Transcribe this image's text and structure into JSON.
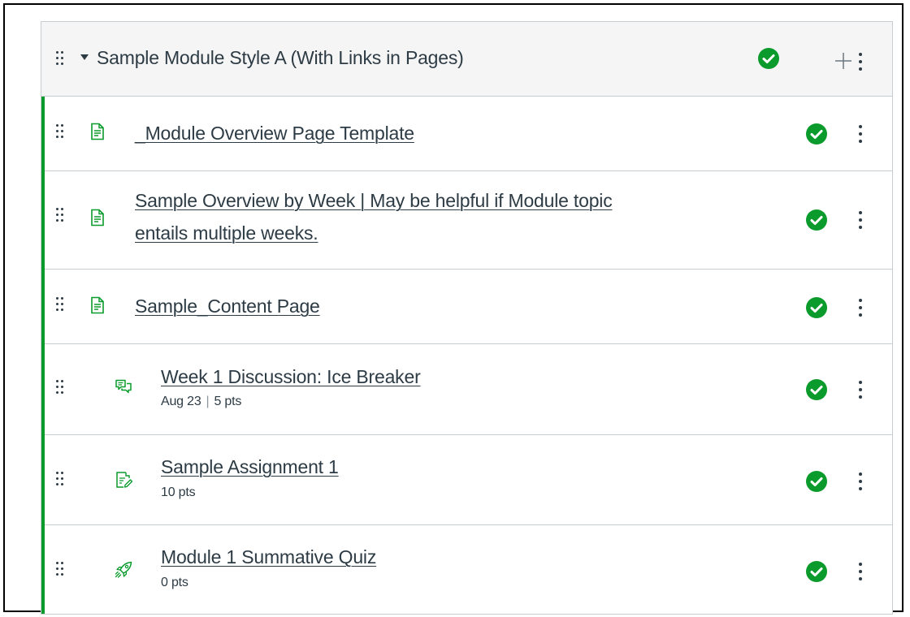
{
  "module": {
    "title": "Sample Module Style A (With Links in Pages)",
    "published_status": "published",
    "accent_color": "#0b9b2d",
    "icons": {
      "collapse": "caret-down-icon",
      "publish": "check-circle-icon",
      "add": "plus-icon",
      "menu": "more-vertical-icon",
      "drag": "drag-handle-icon"
    }
  },
  "items": [
    {
      "type_icon": "page-icon",
      "title_lines": [
        "_Module Overview Page Template"
      ],
      "meta": null
    },
    {
      "type_icon": "page-icon",
      "title_lines": [
        "Sample Overview by Week | May be helpful if Module topic",
        "entails multiple weeks."
      ],
      "meta": null
    },
    {
      "type_icon": "page-icon",
      "title_lines": [
        "Sample_Content Page"
      ],
      "meta": null
    },
    {
      "type_icon": "discussion-icon",
      "title_lines": [
        "Week 1 Discussion: Ice Breaker"
      ],
      "meta": {
        "date": "Aug 23",
        "separator": "|",
        "points": "5 pts"
      }
    },
    {
      "type_icon": "assignment-icon",
      "title_lines": [
        "Sample Assignment 1"
      ],
      "meta": {
        "points": "10 pts"
      }
    },
    {
      "type_icon": "quiz-icon",
      "title_lines": [
        "Module 1 Summative Quiz"
      ],
      "meta": {
        "points": "0 pts"
      }
    }
  ]
}
